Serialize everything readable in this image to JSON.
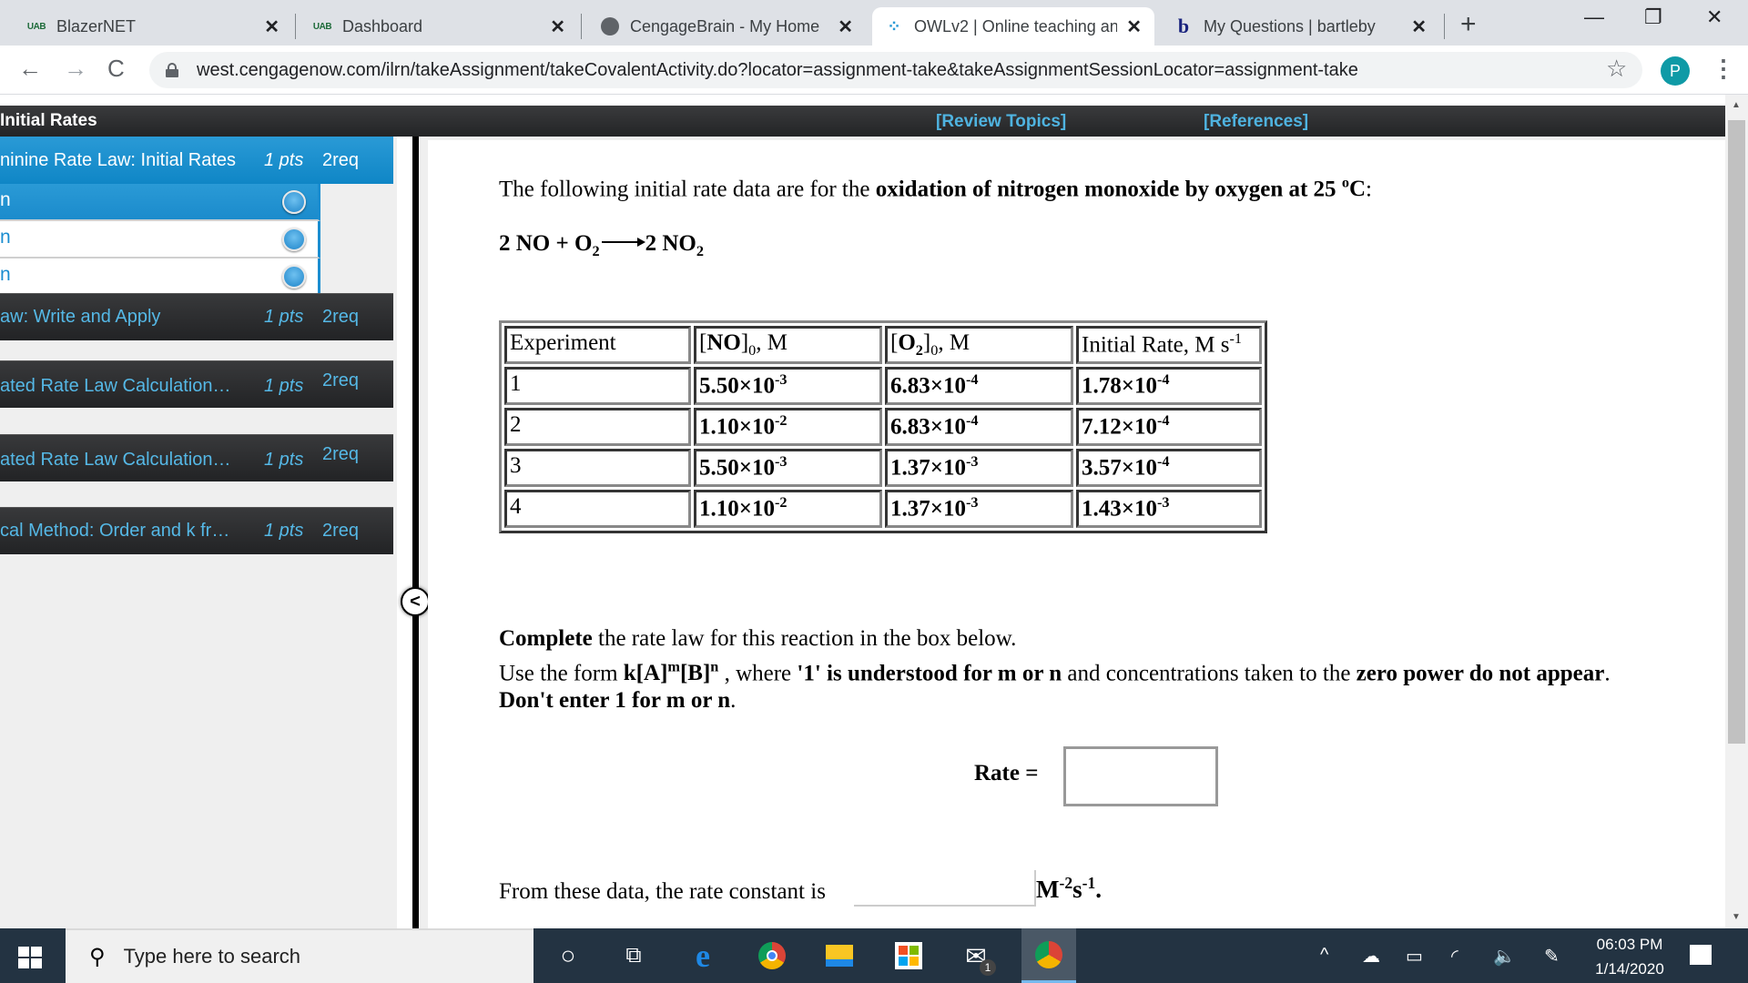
{
  "browser": {
    "tabs": [
      {
        "favicon": "uab-logo-icon",
        "title": "BlazerNET",
        "active": false
      },
      {
        "favicon": "uab-logo-icon",
        "title": "Dashboard",
        "active": false
      },
      {
        "favicon": "globe-icon",
        "title": "CengageBrain - My Home",
        "active": false
      },
      {
        "favicon": "owl-sparkle-icon",
        "title": "OWLv2 | Online teaching an",
        "active": true
      },
      {
        "favicon": "bartleby-b-icon",
        "title": "My Questions | bartleby",
        "active": false
      }
    ],
    "tab_close_glyph": "✕",
    "new_tab_glyph": "+",
    "window_controls": {
      "minimize": "—",
      "restore": "❐",
      "close": "✕"
    },
    "nav": {
      "back": "←",
      "forward": "→",
      "reload": "C"
    },
    "url": "west.cengagenow.com/ilrn/takeAssignment/takeCovalentActivity.do?locator=assignment-take&takeAssignmentSessionLocator=assignment-take",
    "bookmark_glyph": "☆",
    "profile_initial": "P",
    "menu_glyph": "⋮"
  },
  "owl": {
    "header": {
      "title": "Initial Rates",
      "review_topics": "[Review Topics]",
      "references": "[References]"
    },
    "sidebar": {
      "items": [
        {
          "label": "ninine Rate Law: Initial Rates",
          "pts": "1 pts",
          "req": "2req",
          "active": true
        },
        {
          "label": "aw: Write and Apply",
          "pts": "1 pts",
          "req": "2req",
          "active": false
        },
        {
          "label": "ated Rate Law Calculation…",
          "pts": "1 pts",
          "req": "2req",
          "active": false
        },
        {
          "label": "ated Rate Law Calculation…",
          "pts": "1 pts",
          "req": "2req",
          "active": false
        },
        {
          "label": "cal Method: Order and k fr…",
          "pts": "1 pts",
          "req": "2req",
          "active": false
        }
      ],
      "subitems": [
        {
          "label": "n",
          "active": true
        },
        {
          "label": "n",
          "active": false
        },
        {
          "label": "n",
          "active": false
        }
      ],
      "collapse_glyph": "<"
    },
    "question": {
      "intro_plain": "The following initial rate data are for the ",
      "intro_bold": "oxidation of nitrogen monoxide by oxygen at 25 ",
      "intro_deg": "o",
      "intro_unit": "C",
      "intro_end": ":",
      "equation": {
        "lhs": "2 NO + O",
        "lhs_sub": "2",
        "rhs": "2 NO",
        "rhs_sub": "2"
      },
      "table": {
        "headers": [
          {
            "pre": "Experiment",
            "bold": "",
            "sub": "",
            "post": "",
            "sub0": "",
            "tail": "",
            "sup": ""
          },
          {
            "pre": "[",
            "bold": "NO",
            "sub": "",
            "post": "]",
            "sub0": "0",
            "tail": ", M",
            "sup": ""
          },
          {
            "pre": "[",
            "bold": "O",
            "sub": "2",
            "post": "]",
            "sub0": "0",
            "tail": ", M",
            "sup": ""
          },
          {
            "pre": "Initial Rate, M s",
            "bold": "",
            "sub": "",
            "post": "",
            "sub0": "",
            "tail": "",
            "sup": "-1"
          }
        ],
        "rows": [
          {
            "experiment": "1",
            "no": {
              "m": "5.50×10",
              "e": "-3"
            },
            "o2": {
              "m": "6.83×10",
              "e": "-4"
            },
            "rate": {
              "m": "1.78×10",
              "e": "-4"
            }
          },
          {
            "experiment": "2",
            "no": {
              "m": "1.10×10",
              "e": "-2"
            },
            "o2": {
              "m": "6.83×10",
              "e": "-4"
            },
            "rate": {
              "m": "7.12×10",
              "e": "-4"
            }
          },
          {
            "experiment": "3",
            "no": {
              "m": "5.50×10",
              "e": "-3"
            },
            "o2": {
              "m": "1.37×10",
              "e": "-3"
            },
            "rate": {
              "m": "3.57×10",
              "e": "-4"
            }
          },
          {
            "experiment": "4",
            "no": {
              "m": "1.10×10",
              "e": "-2"
            },
            "o2": {
              "m": "1.37×10",
              "e": "-3"
            },
            "rate": {
              "m": "1.43×10",
              "e": "-3"
            }
          }
        ]
      },
      "instructions": {
        "line1_bold": "Complete",
        "line1_rest": " the rate law for this reaction in the box below.",
        "line2_a": "Use the form ",
        "line2_form_k": "k[A]",
        "line2_form_m": "m",
        "line2_form_b": "[B]",
        "line2_form_n": "n",
        "line2_b": " , where ",
        "line2_c": "'1' is understood for m or n",
        "line2_d": " and concentrations taken to the ",
        "line2_e": "zero power do not appear",
        "line2_f": ".",
        "line3_bold": "Don't enter 1 for m or n",
        "line3_end": "."
      },
      "rate_label": "Rate =",
      "rate_value": "",
      "k_label": "From these data, the rate constant is",
      "k_value": "",
      "k_units_m": "M",
      "k_units_m_exp": "-2",
      "k_units_s": "s",
      "k_units_s_exp": "-1",
      "k_units_end": "."
    }
  },
  "taskbar": {
    "search_placeholder": "Type here to search",
    "apps": [
      "cortana-icon",
      "task-view-icon",
      "edge-icon",
      "chrome-icon",
      "file-explorer-icon",
      "store-icon",
      "mail-icon",
      "chrome-profile-icon"
    ],
    "mail_badge": "1",
    "tray_chevron": "^",
    "time": "06:03 PM",
    "date": "1/14/2020"
  }
}
